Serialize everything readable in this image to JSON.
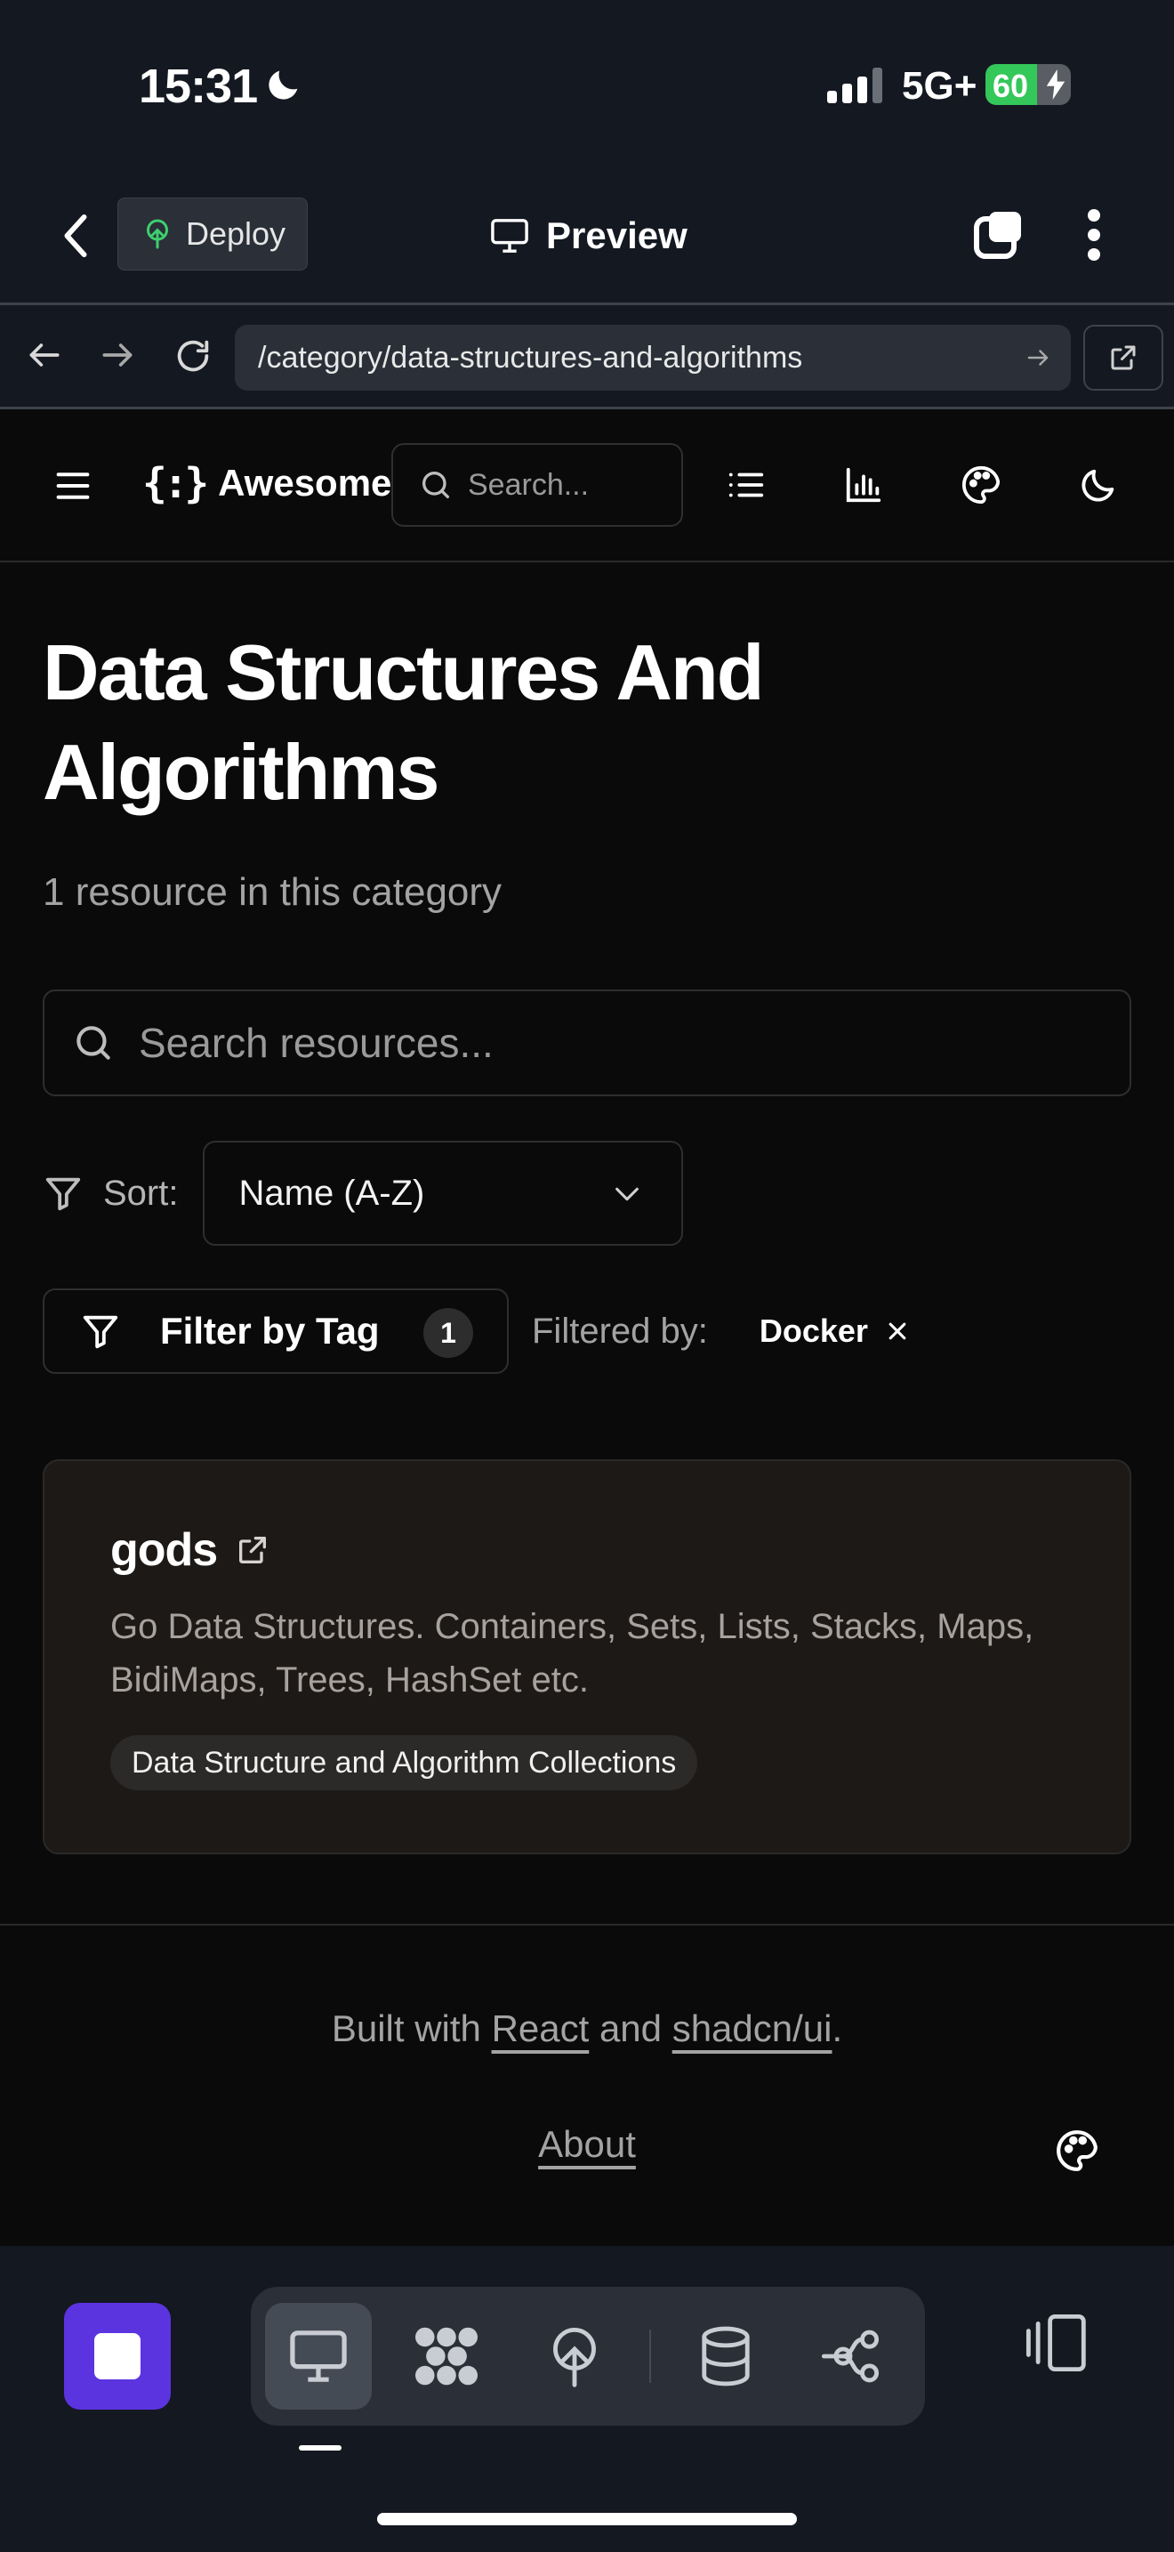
{
  "status_bar": {
    "time": "15:31",
    "network": "5G+",
    "battery": "60",
    "battery_level": 0.6
  },
  "app_header": {
    "deploy_label": "Deploy",
    "preview_label": "Preview"
  },
  "browser": {
    "url": "/category/data-structures-and-algorithms"
  },
  "site_nav": {
    "brand_mark": "{:}",
    "brand_name": "Awesome",
    "search_placeholder": "Search..."
  },
  "main": {
    "title": "Data Structures And Algorithms",
    "subtitle": "1 resource in this category",
    "search_placeholder": "Search resources...",
    "sort_label": "Sort:",
    "sort_value": "Name (A-Z)",
    "filter_button_label": "Filter by Tag",
    "filter_count": "1",
    "filtered_by_label": "Filtered by:",
    "active_tag": "Docker",
    "resources": [
      {
        "title": "gods",
        "description": "Go Data Structures. Containers, Sets, Lists, Stacks, Maps, BidiMaps, Trees, HashSet etc.",
        "tag": "Data Structure and Algorithm Collections"
      }
    ]
  },
  "footer": {
    "built_prefix": "Built with ",
    "react_link": "React",
    "and_text": " and ",
    "shadcn_link": "shadcn/ui",
    "period": ".",
    "about_link": "About"
  },
  "colors": {
    "accent": "#5b34e0",
    "battery_green": "#34c759",
    "card_bg": "#1c1917"
  }
}
